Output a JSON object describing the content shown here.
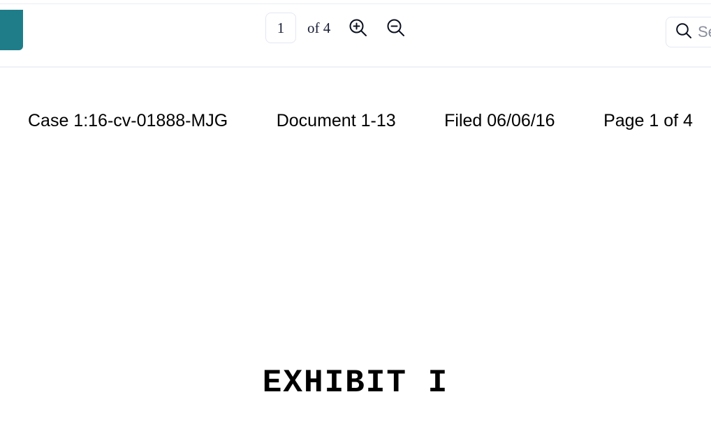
{
  "viewer": {
    "brand_tab": {
      "name": "sidebar-toggle-tab",
      "color": "#1f7d8a"
    },
    "page_controls": {
      "current_page_value": "1",
      "current_page_placeholder": "1",
      "total_pages_label": "of 4",
      "zoom_in_icon": "zoom-in-icon",
      "zoom_in_title": "Zoom in",
      "zoom_out_icon": "zoom-out-icon",
      "zoom_out_title": "Zoom out"
    },
    "search": {
      "icon": "search-icon",
      "value": "",
      "placeholder": "Search"
    }
  },
  "document": {
    "stamp": {
      "case": "Case 1:16-cv-01888-MJG",
      "doc": "Document 1-13",
      "filed": "Filed 06/06/16",
      "page": "Page 1 of 4"
    },
    "exhibit_title": "EXHIBIT I"
  }
}
